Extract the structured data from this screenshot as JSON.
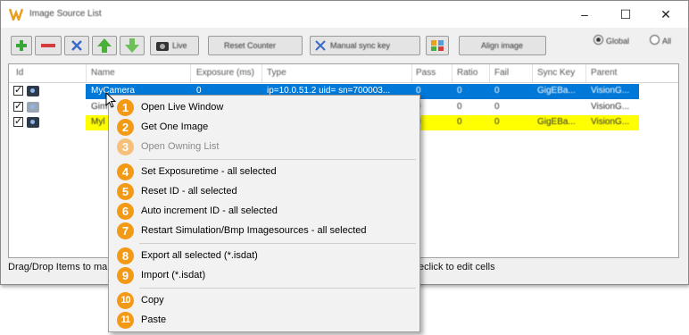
{
  "window": {
    "title": "Image Source List",
    "controls": [
      "–",
      "☐",
      "✕"
    ]
  },
  "toolbar": {
    "live_label": "Live",
    "reset_counter_label": "Reset Counter",
    "manual_sync_key_label": "Manual sync key",
    "align_image_label": "Align image",
    "global_label": "Global",
    "all_label": "All"
  },
  "grid": {
    "columns": [
      "Id",
      "Name",
      "Exposure (ms)",
      "Type",
      "Pass",
      "Ratio",
      "Fail",
      "Sync Key",
      "Parent"
    ],
    "rows": [
      {
        "name": "MyCamera",
        "exposure": "0",
        "type": "ip=10.0.51.2 uid= sn=700003...",
        "pass": "0",
        "ratio": "0",
        "fail": "0",
        "sync_key": "GigEBa...",
        "parent": "VisionG..."
      },
      {
        "name": "Gim",
        "exposure": "",
        "type": "",
        "pass": "0",
        "ratio": "0",
        "fail": "0",
        "sync_key": "",
        "parent": "VisionG..."
      },
      {
        "name": "Myl",
        "exposure": "",
        "type": "",
        "pass": "0",
        "ratio": "0",
        "fail": "0",
        "sync_key": "GigEBa...",
        "parent": "VisionG..."
      }
    ]
  },
  "status": {
    "left": "Drag/Drop Items to ma",
    "right": "eclick to edit cells"
  },
  "context_menu": {
    "items": [
      {
        "num": "1",
        "label": "Open Live Window",
        "enabled": true
      },
      {
        "num": "2",
        "label": "Get One Image",
        "enabled": true
      },
      {
        "num": "3",
        "label": "Open Owning List",
        "enabled": false
      },
      {
        "num": "4",
        "label": "Set Exposuretime - all selected",
        "enabled": true
      },
      {
        "num": "5",
        "label": "Reset ID - all selected",
        "enabled": true
      },
      {
        "num": "6",
        "label": "Auto increment ID - all selected",
        "enabled": true
      },
      {
        "num": "7",
        "label": "Restart Simulation/Bmp Imagesources - all selected",
        "enabled": true
      },
      {
        "num": "8",
        "label": "Export all selected (*.isdat)",
        "enabled": true
      },
      {
        "num": "9",
        "label": "Import (*.isdat)",
        "enabled": true
      },
      {
        "num": "10",
        "label": "Copy",
        "enabled": true
      },
      {
        "num": "11",
        "label": "Paste",
        "enabled": true
      }
    ]
  },
  "colors": {
    "selection": "#0078d7",
    "highlight_row": "#ffff00",
    "badge": "#f29a16"
  },
  "icons": [
    "app-icon",
    "add-icon",
    "remove-icon",
    "clear-icon",
    "move-up-icon",
    "move-down-icon",
    "camera-icon",
    "sync-key-icon",
    "align-icon"
  ]
}
